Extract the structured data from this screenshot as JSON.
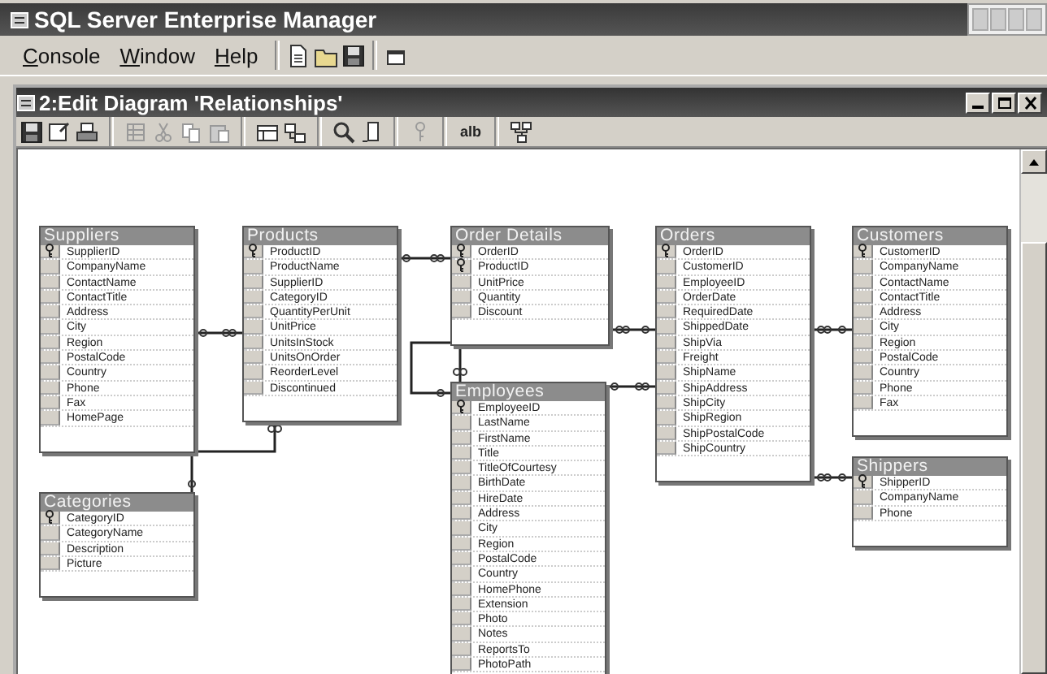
{
  "app": {
    "title": "SQL Server Enterprise Manager",
    "menu": [
      "Console",
      "Window",
      "Help"
    ]
  },
  "diagram_window": {
    "title": "2:Edit Diagram 'Relationships'",
    "toolbar_text": "alb"
  },
  "tables": [
    {
      "name": "Suppliers",
      "columns": [
        {
          "name": "SupplierID",
          "key": true
        },
        {
          "name": "CompanyName",
          "key": false
        },
        {
          "name": "ContactName",
          "key": false
        },
        {
          "name": "ContactTitle",
          "key": false
        },
        {
          "name": "Address",
          "key": false
        },
        {
          "name": "City",
          "key": false
        },
        {
          "name": "Region",
          "key": false
        },
        {
          "name": "PostalCode",
          "key": false
        },
        {
          "name": "Country",
          "key": false
        },
        {
          "name": "Phone",
          "key": false
        },
        {
          "name": "Fax",
          "key": false
        },
        {
          "name": "HomePage",
          "key": false
        }
      ]
    },
    {
      "name": "Products",
      "columns": [
        {
          "name": "ProductID",
          "key": true
        },
        {
          "name": "ProductName",
          "key": false
        },
        {
          "name": "SupplierID",
          "key": false
        },
        {
          "name": "CategoryID",
          "key": false
        },
        {
          "name": "QuantityPerUnit",
          "key": false
        },
        {
          "name": "UnitPrice",
          "key": false
        },
        {
          "name": "UnitsInStock",
          "key": false
        },
        {
          "name": "UnitsOnOrder",
          "key": false
        },
        {
          "name": "ReorderLevel",
          "key": false
        },
        {
          "name": "Discontinued",
          "key": false
        }
      ]
    },
    {
      "name": "Order Details",
      "columns": [
        {
          "name": "OrderID",
          "key": true
        },
        {
          "name": "ProductID",
          "key": true
        },
        {
          "name": "UnitPrice",
          "key": false
        },
        {
          "name": "Quantity",
          "key": false
        },
        {
          "name": "Discount",
          "key": false
        }
      ]
    },
    {
      "name": "Orders",
      "columns": [
        {
          "name": "OrderID",
          "key": true
        },
        {
          "name": "CustomerID",
          "key": false
        },
        {
          "name": "EmployeeID",
          "key": false
        },
        {
          "name": "OrderDate",
          "key": false
        },
        {
          "name": "RequiredDate",
          "key": false
        },
        {
          "name": "ShippedDate",
          "key": false
        },
        {
          "name": "ShipVia",
          "key": false
        },
        {
          "name": "Freight",
          "key": false
        },
        {
          "name": "ShipName",
          "key": false
        },
        {
          "name": "ShipAddress",
          "key": false
        },
        {
          "name": "ShipCity",
          "key": false
        },
        {
          "name": "ShipRegion",
          "key": false
        },
        {
          "name": "ShipPostalCode",
          "key": false
        },
        {
          "name": "ShipCountry",
          "key": false
        }
      ]
    },
    {
      "name": "Customers",
      "columns": [
        {
          "name": "CustomerID",
          "key": true
        },
        {
          "name": "CompanyName",
          "key": false
        },
        {
          "name": "ContactName",
          "key": false
        },
        {
          "name": "ContactTitle",
          "key": false
        },
        {
          "name": "Address",
          "key": false
        },
        {
          "name": "City",
          "key": false
        },
        {
          "name": "Region",
          "key": false
        },
        {
          "name": "PostalCode",
          "key": false
        },
        {
          "name": "Country",
          "key": false
        },
        {
          "name": "Phone",
          "key": false
        },
        {
          "name": "Fax",
          "key": false
        }
      ]
    },
    {
      "name": "Employees",
      "columns": [
        {
          "name": "EmployeeID",
          "key": true
        },
        {
          "name": "LastName",
          "key": false
        },
        {
          "name": "FirstName",
          "key": false
        },
        {
          "name": "Title",
          "key": false
        },
        {
          "name": "TitleOfCourtesy",
          "key": false
        },
        {
          "name": "BirthDate",
          "key": false
        },
        {
          "name": "HireDate",
          "key": false
        },
        {
          "name": "Address",
          "key": false
        },
        {
          "name": "City",
          "key": false
        },
        {
          "name": "Region",
          "key": false
        },
        {
          "name": "PostalCode",
          "key": false
        },
        {
          "name": "Country",
          "key": false
        },
        {
          "name": "HomePhone",
          "key": false
        },
        {
          "name": "Extension",
          "key": false
        },
        {
          "name": "Photo",
          "key": false
        },
        {
          "name": "Notes",
          "key": false
        },
        {
          "name": "ReportsTo",
          "key": false
        },
        {
          "name": "PhotoPath",
          "key": false
        }
      ]
    },
    {
      "name": "Shippers",
      "columns": [
        {
          "name": "ShipperID",
          "key": true
        },
        {
          "name": "CompanyName",
          "key": false
        },
        {
          "name": "Phone",
          "key": false
        }
      ]
    },
    {
      "name": "Categories",
      "columns": [
        {
          "name": "CategoryID",
          "key": true
        },
        {
          "name": "CategoryName",
          "key": false
        },
        {
          "name": "Description",
          "key": false
        },
        {
          "name": "Picture",
          "key": false
        }
      ]
    }
  ]
}
